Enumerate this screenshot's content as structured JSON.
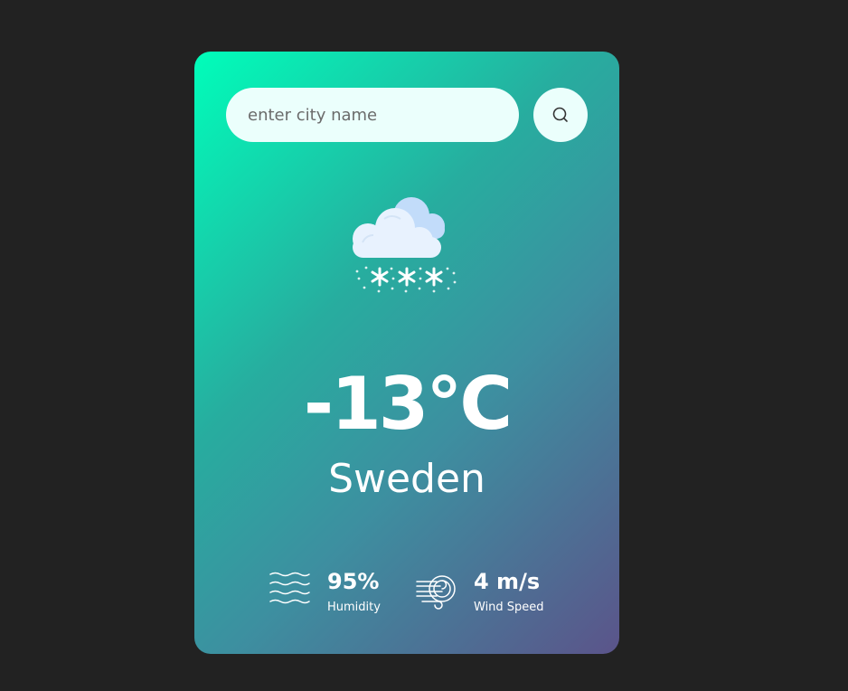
{
  "search": {
    "placeholder": "enter city name",
    "value": ""
  },
  "weather": {
    "icon": "snow-cloud-icon",
    "temperature": "-13°C",
    "city": "Sweden"
  },
  "details": {
    "humidity_value": "95%",
    "humidity_label": "Humidity",
    "humidity_icon": "humidity-waves-icon",
    "wind_value": "4 m/s",
    "wind_label": "Wind Speed",
    "wind_icon": "wind-icon"
  },
  "colors": {
    "background": "#222222",
    "gradient_start": "#00feba",
    "gradient_end": "#5b548a",
    "input_bg": "#ebfffc",
    "text": "#ffffff"
  }
}
